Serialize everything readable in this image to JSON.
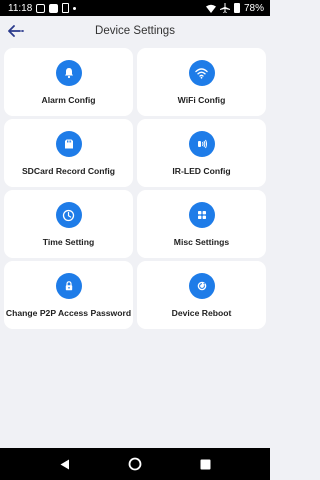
{
  "status_bar": {
    "time": "11:18",
    "battery": "78%"
  },
  "header": {
    "title": "Device Settings",
    "back_icon": "back-arrow-icon"
  },
  "accent_color": "#1e7ce8",
  "settings": [
    {
      "label": "Alarm Config",
      "icon": "bell-icon"
    },
    {
      "label": "WiFi Config",
      "icon": "wifi-icon"
    },
    {
      "label": "SDCard Record Config",
      "icon": "sdcard-icon"
    },
    {
      "label": "IR-LED Config",
      "icon": "ir-led-icon"
    },
    {
      "label": "Time Setting",
      "icon": "clock-icon"
    },
    {
      "label": "Misc Settings",
      "icon": "grid-icon"
    },
    {
      "label": "Change P2P Access Password",
      "icon": "lock-icon"
    },
    {
      "label": "Device Reboot",
      "icon": "reboot-icon"
    }
  ],
  "nav_bar": {
    "back": "nav-back-icon",
    "home": "nav-home-icon",
    "recents": "nav-recents-icon"
  }
}
